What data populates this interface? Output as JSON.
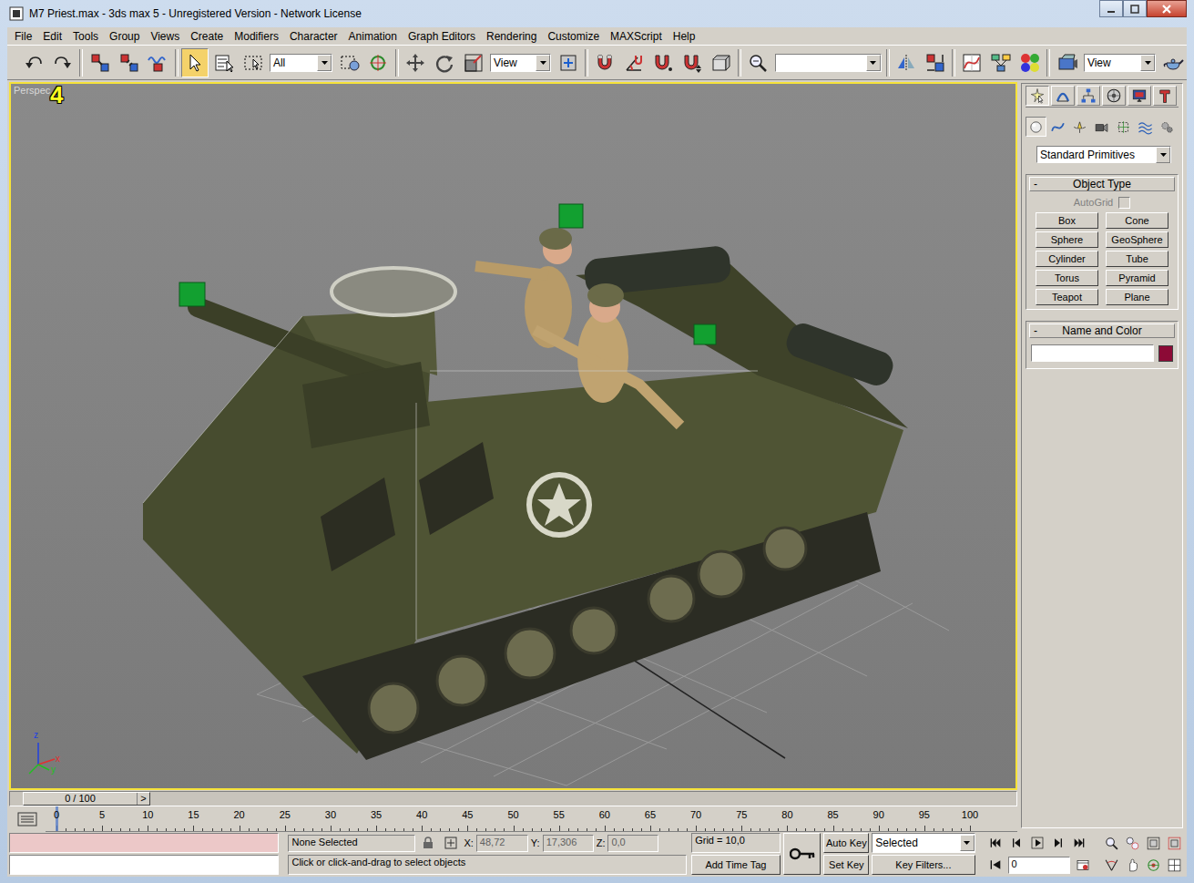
{
  "window": {
    "title": "M7 Priest.max - 3ds max 5 - Unregistered Version - Network License"
  },
  "menu": [
    "File",
    "Edit",
    "Tools",
    "Group",
    "Views",
    "Create",
    "Modifiers",
    "Character",
    "Animation",
    "Graph Editors",
    "Rendering",
    "Customize",
    "MAXScript",
    "Help"
  ],
  "toolbar": [
    {
      "kind": "undo",
      "selected": false
    },
    {
      "kind": "redo",
      "selected": false
    },
    {
      "kind": "sep"
    },
    {
      "kind": "link",
      "selected": false
    },
    {
      "kind": "unlink",
      "selected": false
    },
    {
      "kind": "bind",
      "selected": false
    },
    {
      "kind": "sep"
    },
    {
      "kind": "select",
      "selected": true
    },
    {
      "kind": "selname",
      "selected": false
    },
    {
      "kind": "region",
      "selected": false
    },
    {
      "kind": "filter",
      "value": "All"
    },
    {
      "kind": "crossing",
      "selected": false
    },
    {
      "kind": "manip",
      "selected": false
    },
    {
      "kind": "sep"
    },
    {
      "kind": "move",
      "selected": false
    },
    {
      "kind": "rotate",
      "selected": false
    },
    {
      "kind": "scale",
      "selected": false
    },
    {
      "kind": "coord",
      "value": "View"
    },
    {
      "kind": "pivot",
      "selected": false
    },
    {
      "kind": "sep"
    },
    {
      "kind": "snap",
      "selected": false
    },
    {
      "kind": "angle",
      "selected": false
    },
    {
      "kind": "percent",
      "selected": false
    },
    {
      "kind": "spinner",
      "selected": false
    },
    {
      "kind": "named",
      "selected": false
    },
    {
      "kind": "sep"
    },
    {
      "kind": "abc",
      "selected": false
    },
    {
      "kind": "selset",
      "value": ""
    },
    {
      "kind": "sep"
    },
    {
      "kind": "mirror",
      "selected": false
    },
    {
      "kind": "align",
      "selected": false
    },
    {
      "kind": "sep"
    },
    {
      "kind": "curve",
      "selected": false
    },
    {
      "kind": "schematic",
      "selected": false
    },
    {
      "kind": "material",
      "selected": false
    },
    {
      "kind": "sep"
    },
    {
      "kind": "render",
      "selected": false
    },
    {
      "kind": "rendertype",
      "value": "View"
    },
    {
      "kind": "teapot",
      "selected": false
    }
  ],
  "viewport": {
    "label": "Perspec",
    "number": "4",
    "active": true,
    "axis": {
      "x": "x",
      "y": "y",
      "z": "z"
    }
  },
  "command_panel": {
    "tabs": [
      {
        "kind": "create",
        "selected": true
      },
      {
        "kind": "modify",
        "selected": false
      },
      {
        "kind": "hierarchy",
        "selected": false
      },
      {
        "kind": "motion",
        "selected": false
      },
      {
        "kind": "display",
        "selected": false
      },
      {
        "kind": "utilities",
        "selected": false
      }
    ],
    "categories": [
      {
        "kind": "geometry",
        "selected": true
      },
      {
        "kind": "shapes",
        "selected": false
      },
      {
        "kind": "lights",
        "selected": false
      },
      {
        "kind": "cameras",
        "selected": false
      },
      {
        "kind": "helpers",
        "selected": false
      },
      {
        "kind": "spacewarps",
        "selected": false
      },
      {
        "kind": "systems",
        "selected": false
      }
    ],
    "dropdown": "Standard Primitives",
    "object_type": {
      "title": "Object Type",
      "collapse": "-",
      "autogrid": {
        "label": "AutoGrid",
        "checked": false,
        "disabled": true
      },
      "buttons": [
        "Box",
        "Cone",
        "Sphere",
        "GeoSphere",
        "Cylinder",
        "Tube",
        "Torus",
        "Pyramid",
        "Teapot",
        "Plane"
      ]
    },
    "name_color": {
      "title": "Name and Color",
      "collapse": "-",
      "name": "",
      "color": "#8c0a36"
    }
  },
  "time_slider": {
    "thumb": "0 / 100",
    "next": ">",
    "level": 0
  },
  "trackbar": {
    "ticks": [
      "0",
      "5",
      "10",
      "15",
      "20",
      "25",
      "30",
      "35",
      "40",
      "45",
      "50",
      "55",
      "60",
      "65",
      "70",
      "75",
      "80",
      "85",
      "90",
      "95",
      "100"
    ],
    "current": 0
  },
  "status": {
    "selection": "None Selected",
    "x_label": "X:",
    "x": "48,72",
    "y_label": "Y:",
    "y": "17,306",
    "z_label": "Z:",
    "z": "0,0",
    "grid": "Grid = 10,0",
    "prompt": "Click or click-and-drag to select objects",
    "add_time_tag": "Add Time Tag",
    "auto_key": {
      "label": "Auto Key",
      "on": false
    },
    "set_key": "Set Key",
    "key_mode": "Selected",
    "key_filters": "Key Filters...",
    "frame": "0",
    "playback": [
      {
        "kind": "start",
        "selected": false
      },
      {
        "kind": "prev",
        "selected": false
      },
      {
        "kind": "play",
        "selected": false
      },
      {
        "kind": "next",
        "selected": false
      },
      {
        "kind": "end",
        "selected": false
      }
    ],
    "nav": [
      {
        "kind": "zoom"
      },
      {
        "kind": "zoomall"
      },
      {
        "kind": "extents"
      },
      {
        "kind": "extentsall"
      },
      {
        "kind": "fov"
      },
      {
        "kind": "pan"
      },
      {
        "kind": "orbit"
      },
      {
        "kind": "maximize"
      }
    ]
  }
}
